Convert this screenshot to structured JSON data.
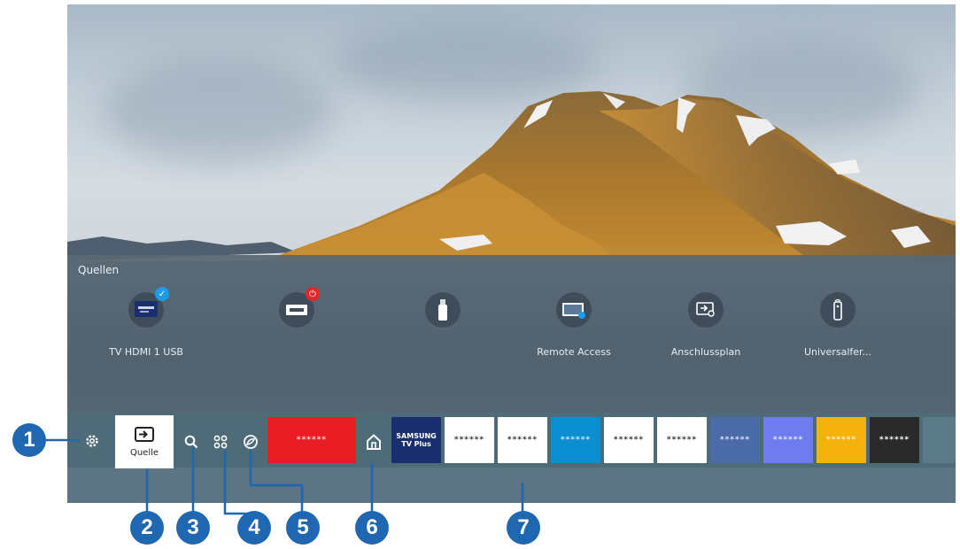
{
  "sources": {
    "title": "Quellen",
    "items": [
      {
        "label": "TV HDMI 1 USB",
        "icon": "samsung-tv-plus-icon",
        "badge": "check"
      },
      {
        "label": "",
        "icon": "hdmi-icon",
        "badge": "power"
      },
      {
        "label": "",
        "icon": "usb-icon",
        "badge": ""
      },
      {
        "label": "Remote Access",
        "icon": "remote-access-icon",
        "badge": ""
      },
      {
        "label": "Anschlussplan",
        "icon": "connection-guide-icon",
        "badge": ""
      },
      {
        "label": "Universalfer...",
        "icon": "universal-remote-icon",
        "badge": ""
      }
    ]
  },
  "menu_bar": {
    "settings_icon": "gear-icon",
    "source_label": "Quelle",
    "search_icon": "search-icon",
    "apps_icon": "apps-icon",
    "ambient_icon": "ambient-icon",
    "home_icon": "home-icon",
    "featured_tile": {
      "text": "******",
      "color": "#ea1c24"
    },
    "app_tiles": [
      {
        "text": "SAMSUNG TV Plus",
        "color": "#1b2f6e",
        "text_color": "#ffffff"
      },
      {
        "text": "******",
        "color": "#ffffff",
        "text_color": "#333333"
      },
      {
        "text": "******",
        "color": "#ffffff",
        "text_color": "#333333"
      },
      {
        "text": "******",
        "color": "#0b8fd0",
        "text_color": "#cfe9f7"
      },
      {
        "text": "******",
        "color": "#ffffff",
        "text_color": "#333333"
      },
      {
        "text": "******",
        "color": "#ffffff",
        "text_color": "#333333"
      },
      {
        "text": "******",
        "color": "#4a6aa8",
        "text_color": "#dde6f5"
      },
      {
        "text": "******",
        "color": "#6f7cf0",
        "text_color": "#e8eaff"
      },
      {
        "text": "******",
        "color": "#f5b20c",
        "text_color": "#fff3cf"
      },
      {
        "text": "******",
        "color": "#2a2a2a",
        "text_color": "#ffffff"
      }
    ]
  },
  "callouts": [
    "1",
    "2",
    "3",
    "4",
    "5",
    "6",
    "7"
  ],
  "colors": {
    "callout": "#1f67b1",
    "accent_check": "#1e9be9",
    "power_badge": "#e3262b"
  }
}
